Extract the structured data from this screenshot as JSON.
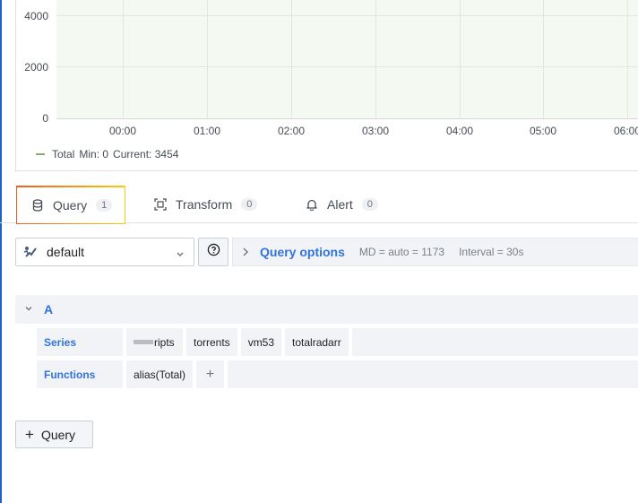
{
  "graph": {
    "y_ticks": [
      "4000",
      "2000",
      "0"
    ],
    "x_ticks": [
      "00:00",
      "01:00",
      "02:00",
      "03:00",
      "04:00",
      "05:00",
      "06:00"
    ],
    "legend": {
      "series_name": "Total",
      "min_text": "Min: 0",
      "current_text": "Current: 3454",
      "series_color": "#7eb26d"
    }
  },
  "tabs": [
    {
      "label": "Query",
      "count": "1",
      "icon": "database-icon"
    },
    {
      "label": "Transform",
      "count": "0",
      "icon": "transform-icon"
    },
    {
      "label": "Alert",
      "count": "0",
      "icon": "bell-icon"
    }
  ],
  "datasource": {
    "selected": "default",
    "logo": "graphite-logo-icon"
  },
  "query_options": {
    "title": "Query options",
    "md": "MD = auto = 1173",
    "interval": "Interval = 30s"
  },
  "query_a": {
    "letter": "A",
    "series_label": "Series",
    "series_segments": [
      "ripts",
      "torrents",
      "vm53",
      "totalradarr"
    ],
    "functions_label": "Functions",
    "functions": [
      "alias(Total)"
    ],
    "add_symbol": "+"
  },
  "add_query": {
    "label": "Query",
    "plus": "+"
  },
  "colors": {
    "accent": "#3274d9",
    "tab_gradient_start": "#f05a28",
    "tab_gradient_end": "#fbca0a"
  }
}
